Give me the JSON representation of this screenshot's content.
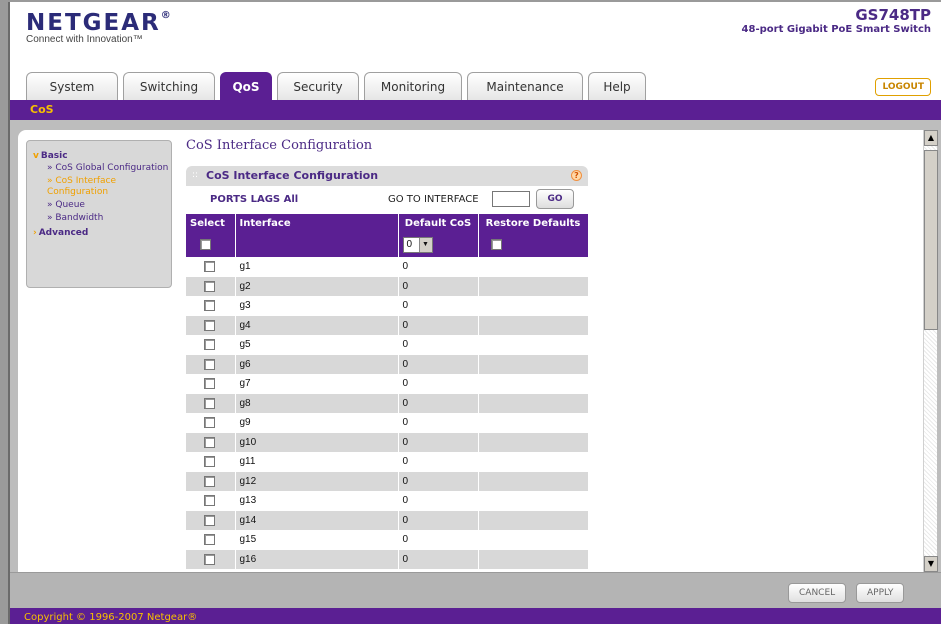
{
  "header": {
    "logo": "NETGEAR",
    "tagline": "Connect with Innovation™",
    "model": "GS748TP",
    "model_desc": "48-port Gigabit PoE Smart Switch"
  },
  "tabs": [
    {
      "label": "System"
    },
    {
      "label": "Switching"
    },
    {
      "label": "QoS",
      "active": true
    },
    {
      "label": "Security"
    },
    {
      "label": "Monitoring"
    },
    {
      "label": "Maintenance"
    },
    {
      "label": "Help"
    }
  ],
  "logout": "LOGOUT",
  "subnav": "CoS",
  "leftnav": {
    "basic": "Basic",
    "items": [
      {
        "label": "» CoS Global Configuration"
      },
      {
        "label": "» CoS Interface Configuration",
        "active": true
      },
      {
        "label": "» Queue"
      },
      {
        "label": "» Bandwidth"
      }
    ],
    "advanced": "Advanced"
  },
  "page_title": "CoS Interface Configuration",
  "panel": {
    "title": "CoS Interface Configuration",
    "ports_links": "PORTS LAGS All",
    "goto_label": "GO TO INTERFACE",
    "goto_value": "",
    "go_button": "GO"
  },
  "table": {
    "headers": [
      "Select",
      "Interface",
      "Default CoS",
      "Restore Defaults"
    ],
    "control_cos": "0",
    "rows": [
      {
        "interface": "g1",
        "cos": "0"
      },
      {
        "interface": "g2",
        "cos": "0"
      },
      {
        "interface": "g3",
        "cos": "0"
      },
      {
        "interface": "g4",
        "cos": "0"
      },
      {
        "interface": "g5",
        "cos": "0"
      },
      {
        "interface": "g6",
        "cos": "0"
      },
      {
        "interface": "g7",
        "cos": "0"
      },
      {
        "interface": "g8",
        "cos": "0"
      },
      {
        "interface": "g9",
        "cos": "0"
      },
      {
        "interface": "g10",
        "cos": "0"
      },
      {
        "interface": "g11",
        "cos": "0"
      },
      {
        "interface": "g12",
        "cos": "0"
      },
      {
        "interface": "g13",
        "cos": "0"
      },
      {
        "interface": "g14",
        "cos": "0"
      },
      {
        "interface": "g15",
        "cos": "0"
      },
      {
        "interface": "g16",
        "cos": "0"
      }
    ]
  },
  "buttons": {
    "cancel": "CANCEL",
    "apply": "APPLY"
  },
  "copyright": "Copyright © 1996-2007 Netgear®",
  "colors": {
    "brand_purple": "#5b1f93",
    "accent_orange": "#f0a000",
    "header_blue": "#2b2b78"
  }
}
